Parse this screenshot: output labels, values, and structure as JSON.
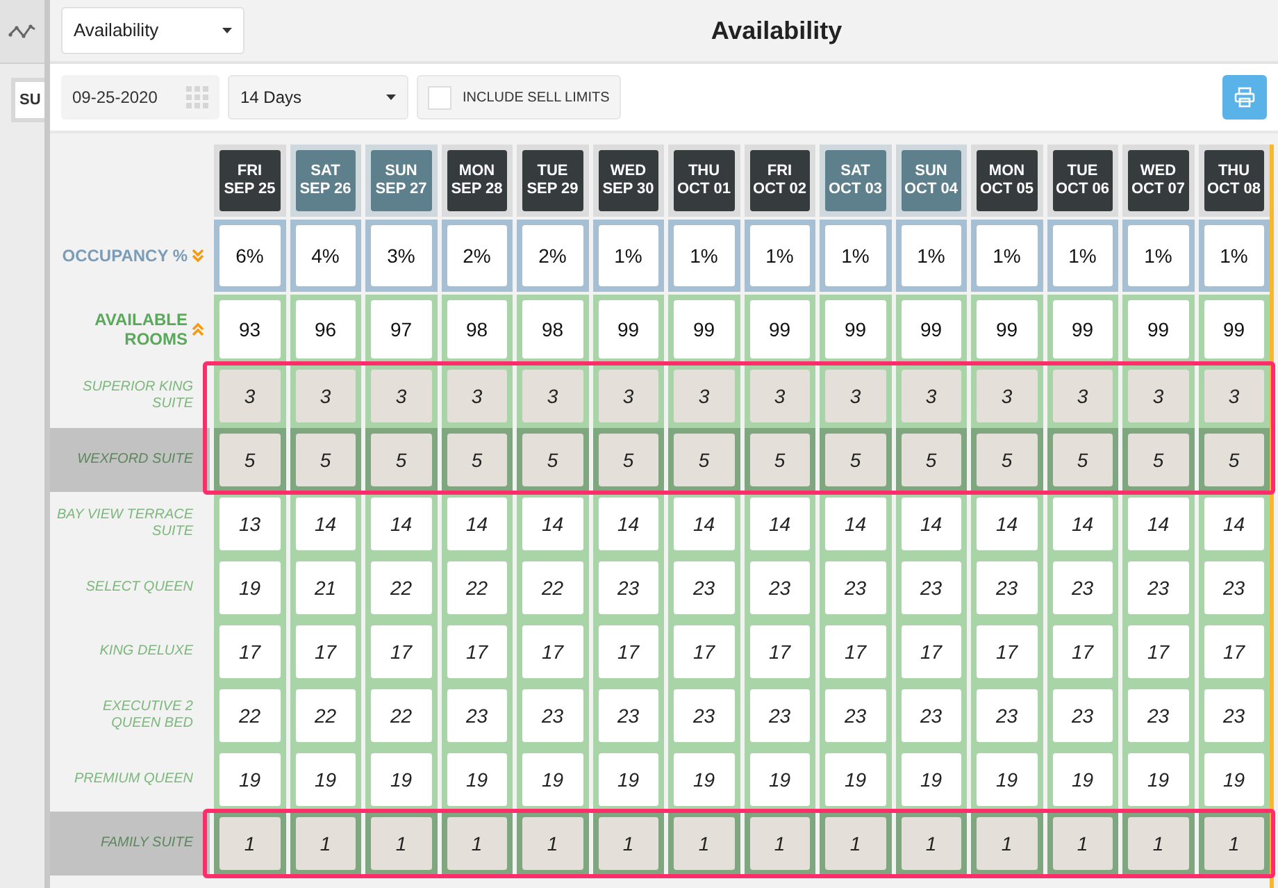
{
  "sidebar": {
    "rail_button": "SU"
  },
  "header": {
    "report_select": "Availability",
    "title": "Availability"
  },
  "toolbar": {
    "date": "09-25-2020",
    "range_select": "14 Days",
    "include_sell_limits": {
      "label": "INCLUDE SELL LIMITS",
      "checked": false
    }
  },
  "days": [
    {
      "weekday": "FRI",
      "date": "SEP 25",
      "weekend": false
    },
    {
      "weekday": "SAT",
      "date": "SEP 26",
      "weekend": true
    },
    {
      "weekday": "SUN",
      "date": "SEP 27",
      "weekend": true
    },
    {
      "weekday": "MON",
      "date": "SEP 28",
      "weekend": false
    },
    {
      "weekday": "TUE",
      "date": "SEP 29",
      "weekend": false
    },
    {
      "weekday": "WED",
      "date": "SEP 30",
      "weekend": false
    },
    {
      "weekday": "THU",
      "date": "OCT 01",
      "weekend": false
    },
    {
      "weekday": "FRI",
      "date": "OCT 02",
      "weekend": false
    },
    {
      "weekday": "SAT",
      "date": "OCT 03",
      "weekend": true
    },
    {
      "weekday": "SUN",
      "date": "OCT 04",
      "weekend": true
    },
    {
      "weekday": "MON",
      "date": "OCT 05",
      "weekend": false
    },
    {
      "weekday": "TUE",
      "date": "OCT 06",
      "weekend": false
    },
    {
      "weekday": "WED",
      "date": "OCT 07",
      "weekend": false
    },
    {
      "weekday": "THU",
      "date": "OCT 08",
      "weekend": false
    }
  ],
  "occupancy": {
    "label": "OCCUPANCY %",
    "expanded": false,
    "values": [
      "6%",
      "4%",
      "3%",
      "2%",
      "2%",
      "1%",
      "1%",
      "1%",
      "1%",
      "1%",
      "1%",
      "1%",
      "1%",
      "1%"
    ]
  },
  "available": {
    "label": "AVAILABLE ROOMS",
    "expanded": true,
    "values": [
      "93",
      "96",
      "97",
      "98",
      "98",
      "99",
      "99",
      "99",
      "99",
      "99",
      "99",
      "99",
      "99",
      "99"
    ]
  },
  "rooms": [
    {
      "name": "SUPERIOR KING SUITE",
      "highlighted": true,
      "selected": false,
      "values": [
        "3",
        "3",
        "3",
        "3",
        "3",
        "3",
        "3",
        "3",
        "3",
        "3",
        "3",
        "3",
        "3",
        "3"
      ]
    },
    {
      "name": "WEXFORD SUITE",
      "highlighted": true,
      "selected": true,
      "values": [
        "5",
        "5",
        "5",
        "5",
        "5",
        "5",
        "5",
        "5",
        "5",
        "5",
        "5",
        "5",
        "5",
        "5"
      ]
    },
    {
      "name": "BAY VIEW TERRACE SUITE",
      "highlighted": false,
      "selected": false,
      "values": [
        "13",
        "14",
        "14",
        "14",
        "14",
        "14",
        "14",
        "14",
        "14",
        "14",
        "14",
        "14",
        "14",
        "14"
      ]
    },
    {
      "name": "SELECT QUEEN",
      "highlighted": false,
      "selected": false,
      "values": [
        "19",
        "21",
        "22",
        "22",
        "22",
        "23",
        "23",
        "23",
        "23",
        "23",
        "23",
        "23",
        "23",
        "23"
      ]
    },
    {
      "name": "KING DELUXE",
      "highlighted": false,
      "selected": false,
      "values": [
        "17",
        "17",
        "17",
        "17",
        "17",
        "17",
        "17",
        "17",
        "17",
        "17",
        "17",
        "17",
        "17",
        "17"
      ]
    },
    {
      "name": "EXECUTIVE 2 QUEEN BED",
      "highlighted": false,
      "selected": false,
      "values": [
        "22",
        "22",
        "22",
        "23",
        "23",
        "23",
        "23",
        "23",
        "23",
        "23",
        "23",
        "23",
        "23",
        "23"
      ]
    },
    {
      "name": "PREMIUM QUEEN",
      "highlighted": false,
      "selected": false,
      "values": [
        "19",
        "19",
        "19",
        "19",
        "19",
        "19",
        "19",
        "19",
        "19",
        "19",
        "19",
        "19",
        "19",
        "19"
      ]
    },
    {
      "name": "FAMILY SUITE",
      "highlighted": true,
      "selected": true,
      "values": [
        "1",
        "1",
        "1",
        "1",
        "1",
        "1",
        "1",
        "1",
        "1",
        "1",
        "1",
        "1",
        "1",
        "1"
      ]
    }
  ]
}
